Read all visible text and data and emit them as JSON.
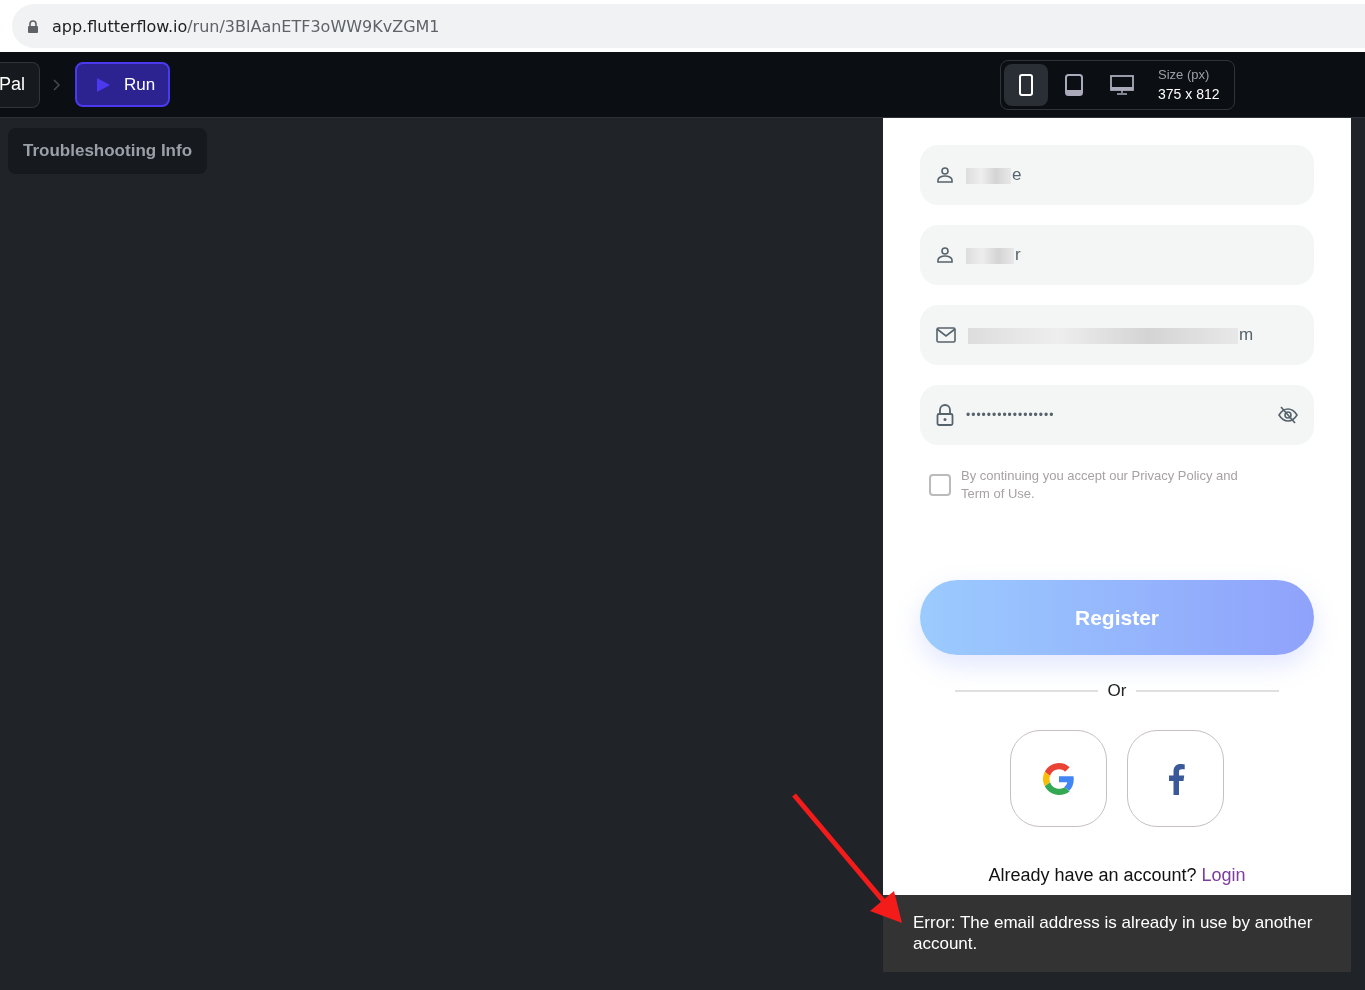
{
  "address_bar": {
    "host": "app.flutterflow.io",
    "path": "/run/3BlAanETF3oWW9KvZGM1"
  },
  "toolbar": {
    "breadcrumb": "Pal",
    "run_button": "Run",
    "devices": [
      {
        "kind": "phone",
        "selected": true
      },
      {
        "kind": "tablet",
        "selected": false
      },
      {
        "kind": "desktop",
        "selected": false
      }
    ],
    "size_label": "Size (px)",
    "size_value": "375 x 812"
  },
  "troubleshooting_button": "Troubleshooting Info",
  "form": {
    "fields": [
      {
        "kind": "person",
        "value": "e",
        "redacted": true
      },
      {
        "kind": "person",
        "value": "r",
        "redacted": true
      },
      {
        "kind": "email",
        "value": "m",
        "redacted": true
      },
      {
        "kind": "password",
        "value": "•••••••••••••••••",
        "redacted": false
      }
    ],
    "terms": {
      "checked": false,
      "text": "By continuing you accept our Privacy Policy and Term of Use."
    },
    "register_button": "Register",
    "divider": "Or",
    "social": [
      {
        "kind": "google"
      },
      {
        "kind": "facebook"
      }
    ],
    "login_prompt": "Already have an account?",
    "login_link": "Login"
  },
  "snackbar": "Error: The email address is already in use by another account."
}
